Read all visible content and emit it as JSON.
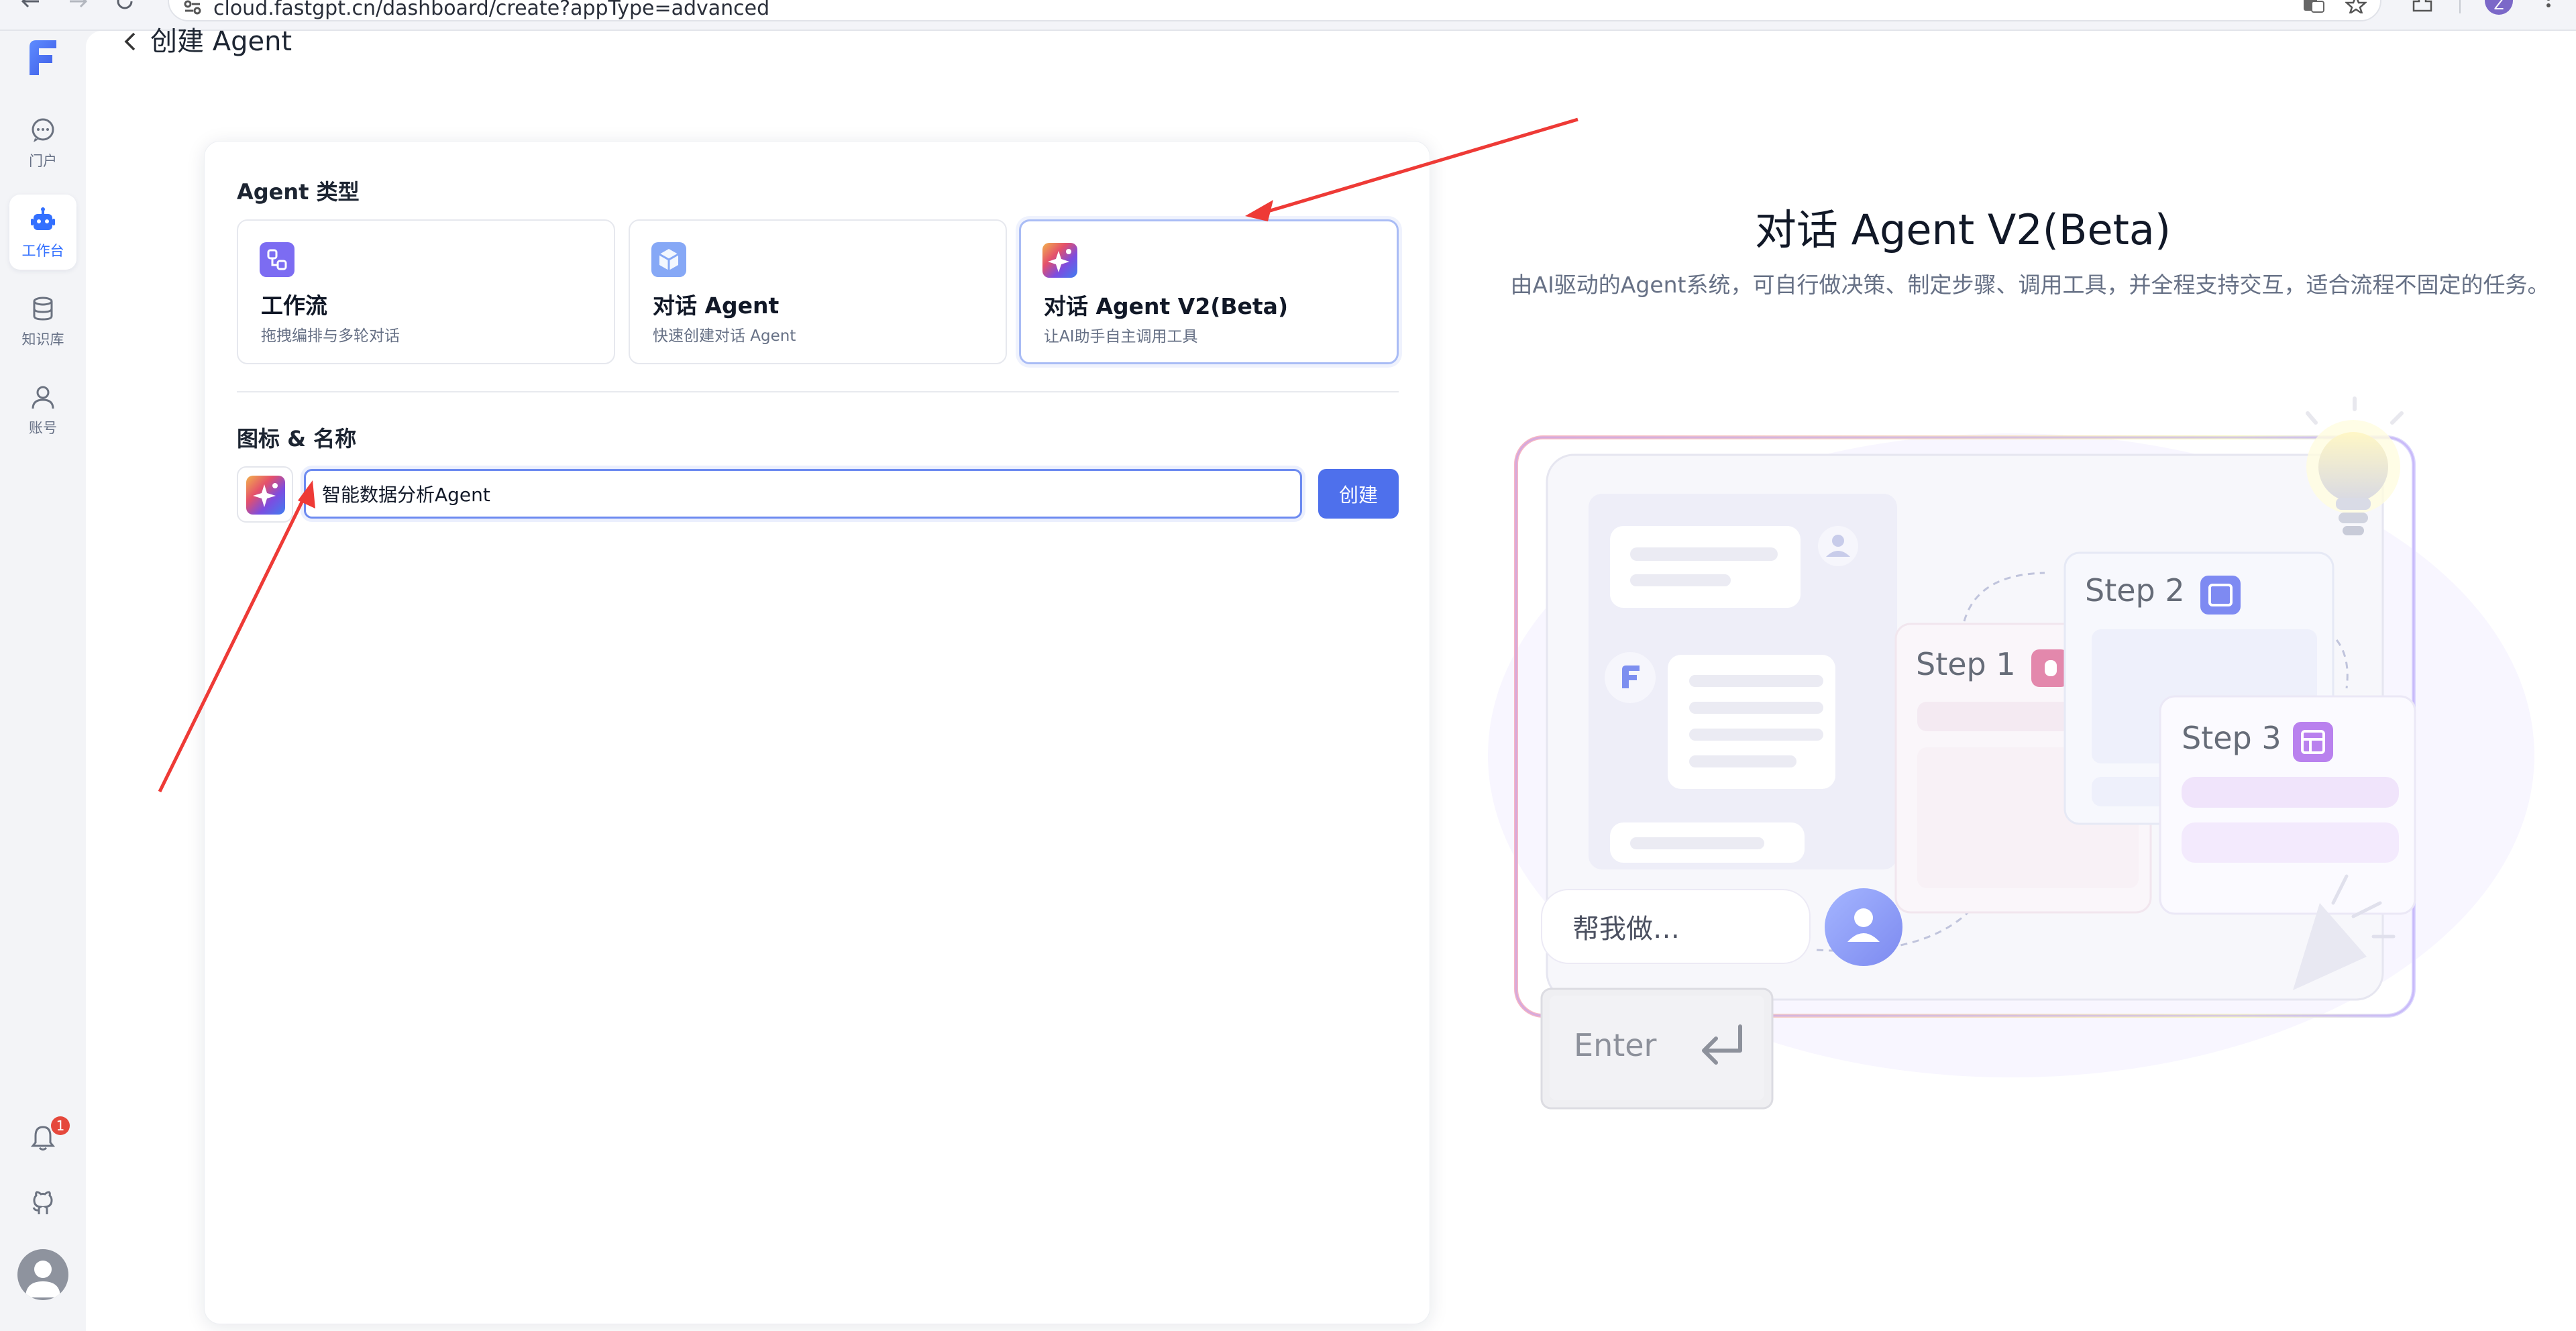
{
  "browser": {
    "url": "cloud.fastgpt.cn/dashboard/create?appType=advanced",
    "profile_initial": "Z"
  },
  "sidebar": {
    "items": [
      {
        "label": "门户",
        "icon": "chat-bubble-icon"
      },
      {
        "label": "工作台",
        "icon": "robot-icon",
        "active": true
      },
      {
        "label": "知识库",
        "icon": "database-icon"
      },
      {
        "label": "账号",
        "icon": "user-icon"
      }
    ],
    "notification_count": "1"
  },
  "header": {
    "title": "创建 Agent"
  },
  "form": {
    "type_label": "Agent 类型",
    "types": [
      {
        "name": "工作流",
        "desc": "拖拽编排与多轮对话",
        "icon": "workflow-icon",
        "color": "#7c6cf2"
      },
      {
        "name": "对话 Agent",
        "desc": "快速创建对话 Agent",
        "icon": "cube-icon",
        "color": "#7ea2f5"
      },
      {
        "name": "对话 Agent V2(Beta)",
        "desc": "让AI助手自主调用工具",
        "icon": "sparkle-gradient-icon",
        "selected": true
      }
    ],
    "name_label": "图标 & 名称",
    "name_value": "智能数据分析Agent",
    "create_label": "创建"
  },
  "preview": {
    "title": "对话 Agent V2(Beta)",
    "desc": "由AI驱动的Agent系统，可自行做决策、制定步骤、调用工具，并全程支持交互，适合流程不固定的任务。",
    "step1": "Step 1",
    "step2": "Step 2",
    "step3": "Step 3",
    "prompt": "帮我做…",
    "enter_key": "Enter"
  },
  "colors": {
    "accent": "#4e70ec",
    "arrow": "#ee3a36"
  }
}
